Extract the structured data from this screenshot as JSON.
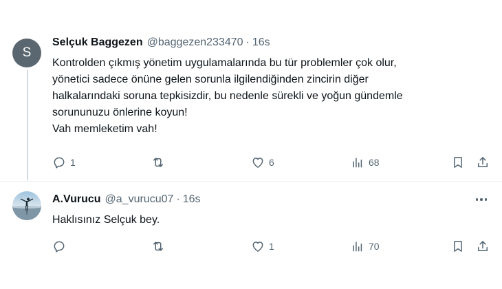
{
  "tweets": [
    {
      "avatar_letter": "S",
      "display_name": "Selçuk Baggezen",
      "handle": "@baggezen233470",
      "separator": "·",
      "time": "16s",
      "text_lines": [
        "Kontrolden çıkmış yönetim uygulamalarında bu tür problemler çok olur,",
        "yönetici sadece önüne gelen sorunla ilgilendiğinden zincirin diğer",
        "halkalarındaki soruna tepkisizdir, bu nedenle sürekli ve yoğun gündemle",
        "sorununuzu önlerine koyun!",
        "Vah memleketim vah!"
      ],
      "actions": {
        "replies": "1",
        "reposts": "",
        "likes": "6",
        "views": "68"
      }
    },
    {
      "display_name": "A.Vurucu",
      "handle": "@a_vurucu07",
      "separator": "·",
      "time": "16s",
      "text_lines": [
        "Haklısınız Selçuk bey."
      ],
      "actions": {
        "replies": "",
        "reposts": "",
        "likes": "1",
        "views": "70"
      }
    }
  ],
  "colors": {
    "text_primary": "#0f1419",
    "text_secondary": "#536471",
    "divider": "#eff3f4",
    "avatar_s_bg": "#5b6770"
  },
  "icons": [
    "reply-icon",
    "repost-icon",
    "like-icon",
    "views-icon",
    "bookmark-icon",
    "share-icon",
    "more-icon"
  ]
}
